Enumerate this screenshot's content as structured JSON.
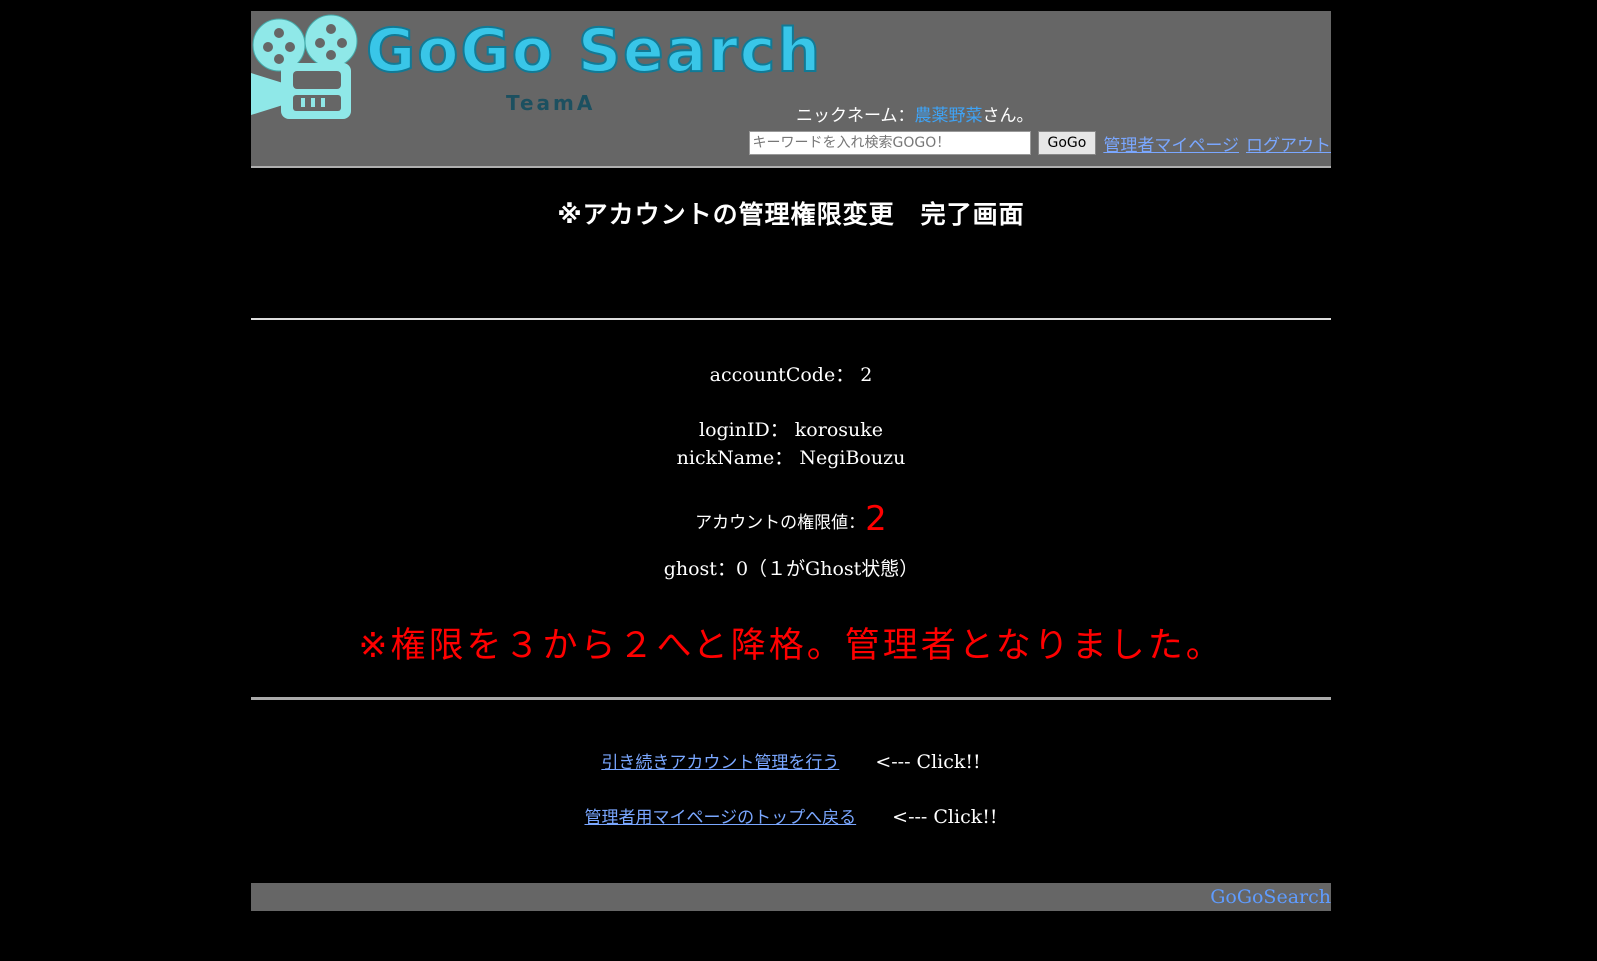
{
  "header": {
    "logo_text": "GoGo Search",
    "logo_sub": "TeamA",
    "nick_prefix": "ニックネーム：",
    "nick_name": "農薬野菜",
    "nick_suffix": "さん。",
    "search_placeholder": "キーワードを入れ検索GOGO！",
    "search_button": "GoGo",
    "link_mypage": "管理者マイページ",
    "link_logout": "ログアウト",
    "logo_color": "#39c6e8",
    "bg_color": "#666666"
  },
  "main": {
    "title": "※アカウントの管理権限変更　完了画面",
    "account_code_label": "accountCode：",
    "account_code": "2",
    "login_id_label": "loginID：",
    "login_id": "korosuke",
    "nick_name_label": "nickName：",
    "nick_name": "NegiBouzu",
    "authority_label": "アカウントの権限値：",
    "authority_value": "2",
    "ghost_text": "ghost：0（１がGhost状態）",
    "notice": "※権限を３から２へと降格。管理者となりました。",
    "notice_color": "#ff0000"
  },
  "nav": {
    "link_account_manage": "引き続きアカウント管理を行う",
    "link_admin_top": "管理者用マイページのトップへ戻る",
    "click_hint": "<--- Click!!"
  },
  "footer": {
    "link": "GoGoSearch"
  }
}
